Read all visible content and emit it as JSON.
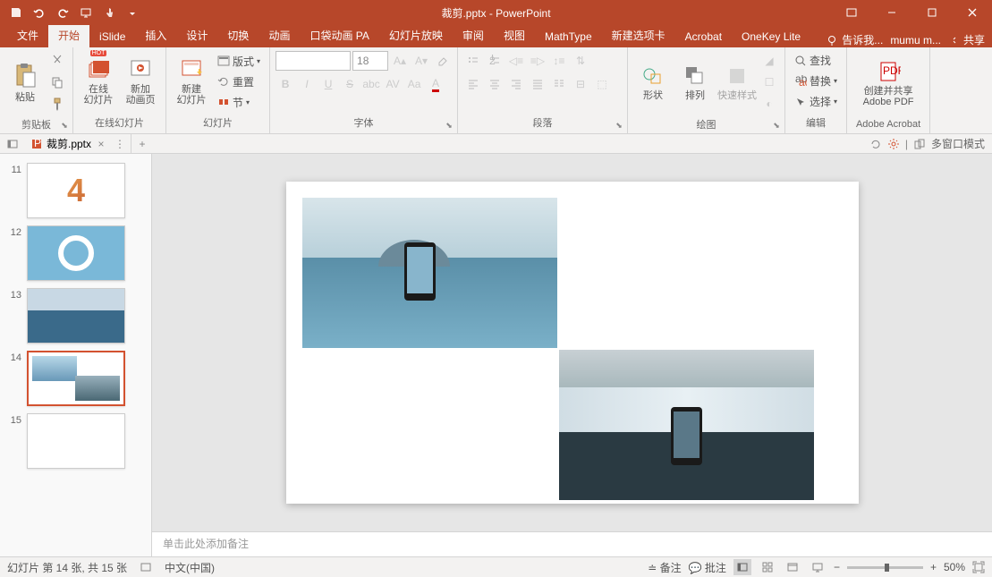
{
  "title": "裁剪.pptx - PowerPoint",
  "tabs": {
    "file": "文件",
    "home": "开始",
    "islide": "iSlide",
    "insert": "插入",
    "design": "设计",
    "transitions": "切换",
    "animations": "动画",
    "pocket_anim": "口袋动画 PA",
    "slideshow": "幻灯片放映",
    "review": "审阅",
    "view": "视图",
    "mathtype": "MathType",
    "new_tab": "新建选项卡",
    "acrobat": "Acrobat",
    "onekey": "OneKey Lite"
  },
  "tell_me": "告诉我...",
  "user": "mumu m...",
  "share": "共享",
  "ribbon": {
    "clipboard": {
      "label": "剪贴板",
      "paste": "粘贴"
    },
    "online_slides": {
      "label": "在线幻灯片",
      "online": "在线\n幻灯片",
      "new_anim": "新加\n动画页"
    },
    "slides": {
      "label": "幻灯片",
      "new_slide": "新建\n幻灯片",
      "layout": "版式",
      "reset": "重置",
      "section": "节"
    },
    "font": {
      "label": "字体",
      "font_name": "",
      "font_size": "18"
    },
    "paragraph": {
      "label": "段落"
    },
    "drawing": {
      "label": "绘图",
      "shapes": "形状",
      "arrange": "排列",
      "quick_styles": "快速样式"
    },
    "editing": {
      "label": "编辑",
      "find": "查找",
      "replace": "替换",
      "select": "选择"
    },
    "adobe": {
      "label": "Adobe Acrobat",
      "create_share": "创建并共享\nAdobe PDF"
    }
  },
  "doctab": {
    "name": "裁剪.pptx"
  },
  "multi_window": "多窗口模式",
  "thumbs": [
    {
      "num": "11"
    },
    {
      "num": "12"
    },
    {
      "num": "13"
    },
    {
      "num": "14",
      "selected": true
    },
    {
      "num": "15"
    }
  ],
  "notes_placeholder": "单击此处添加备注",
  "status": {
    "slide_info": "幻灯片 第 14 张, 共 15 张",
    "language": "中文(中国)",
    "notes": "备注",
    "comments": "批注",
    "zoom": "50%"
  }
}
